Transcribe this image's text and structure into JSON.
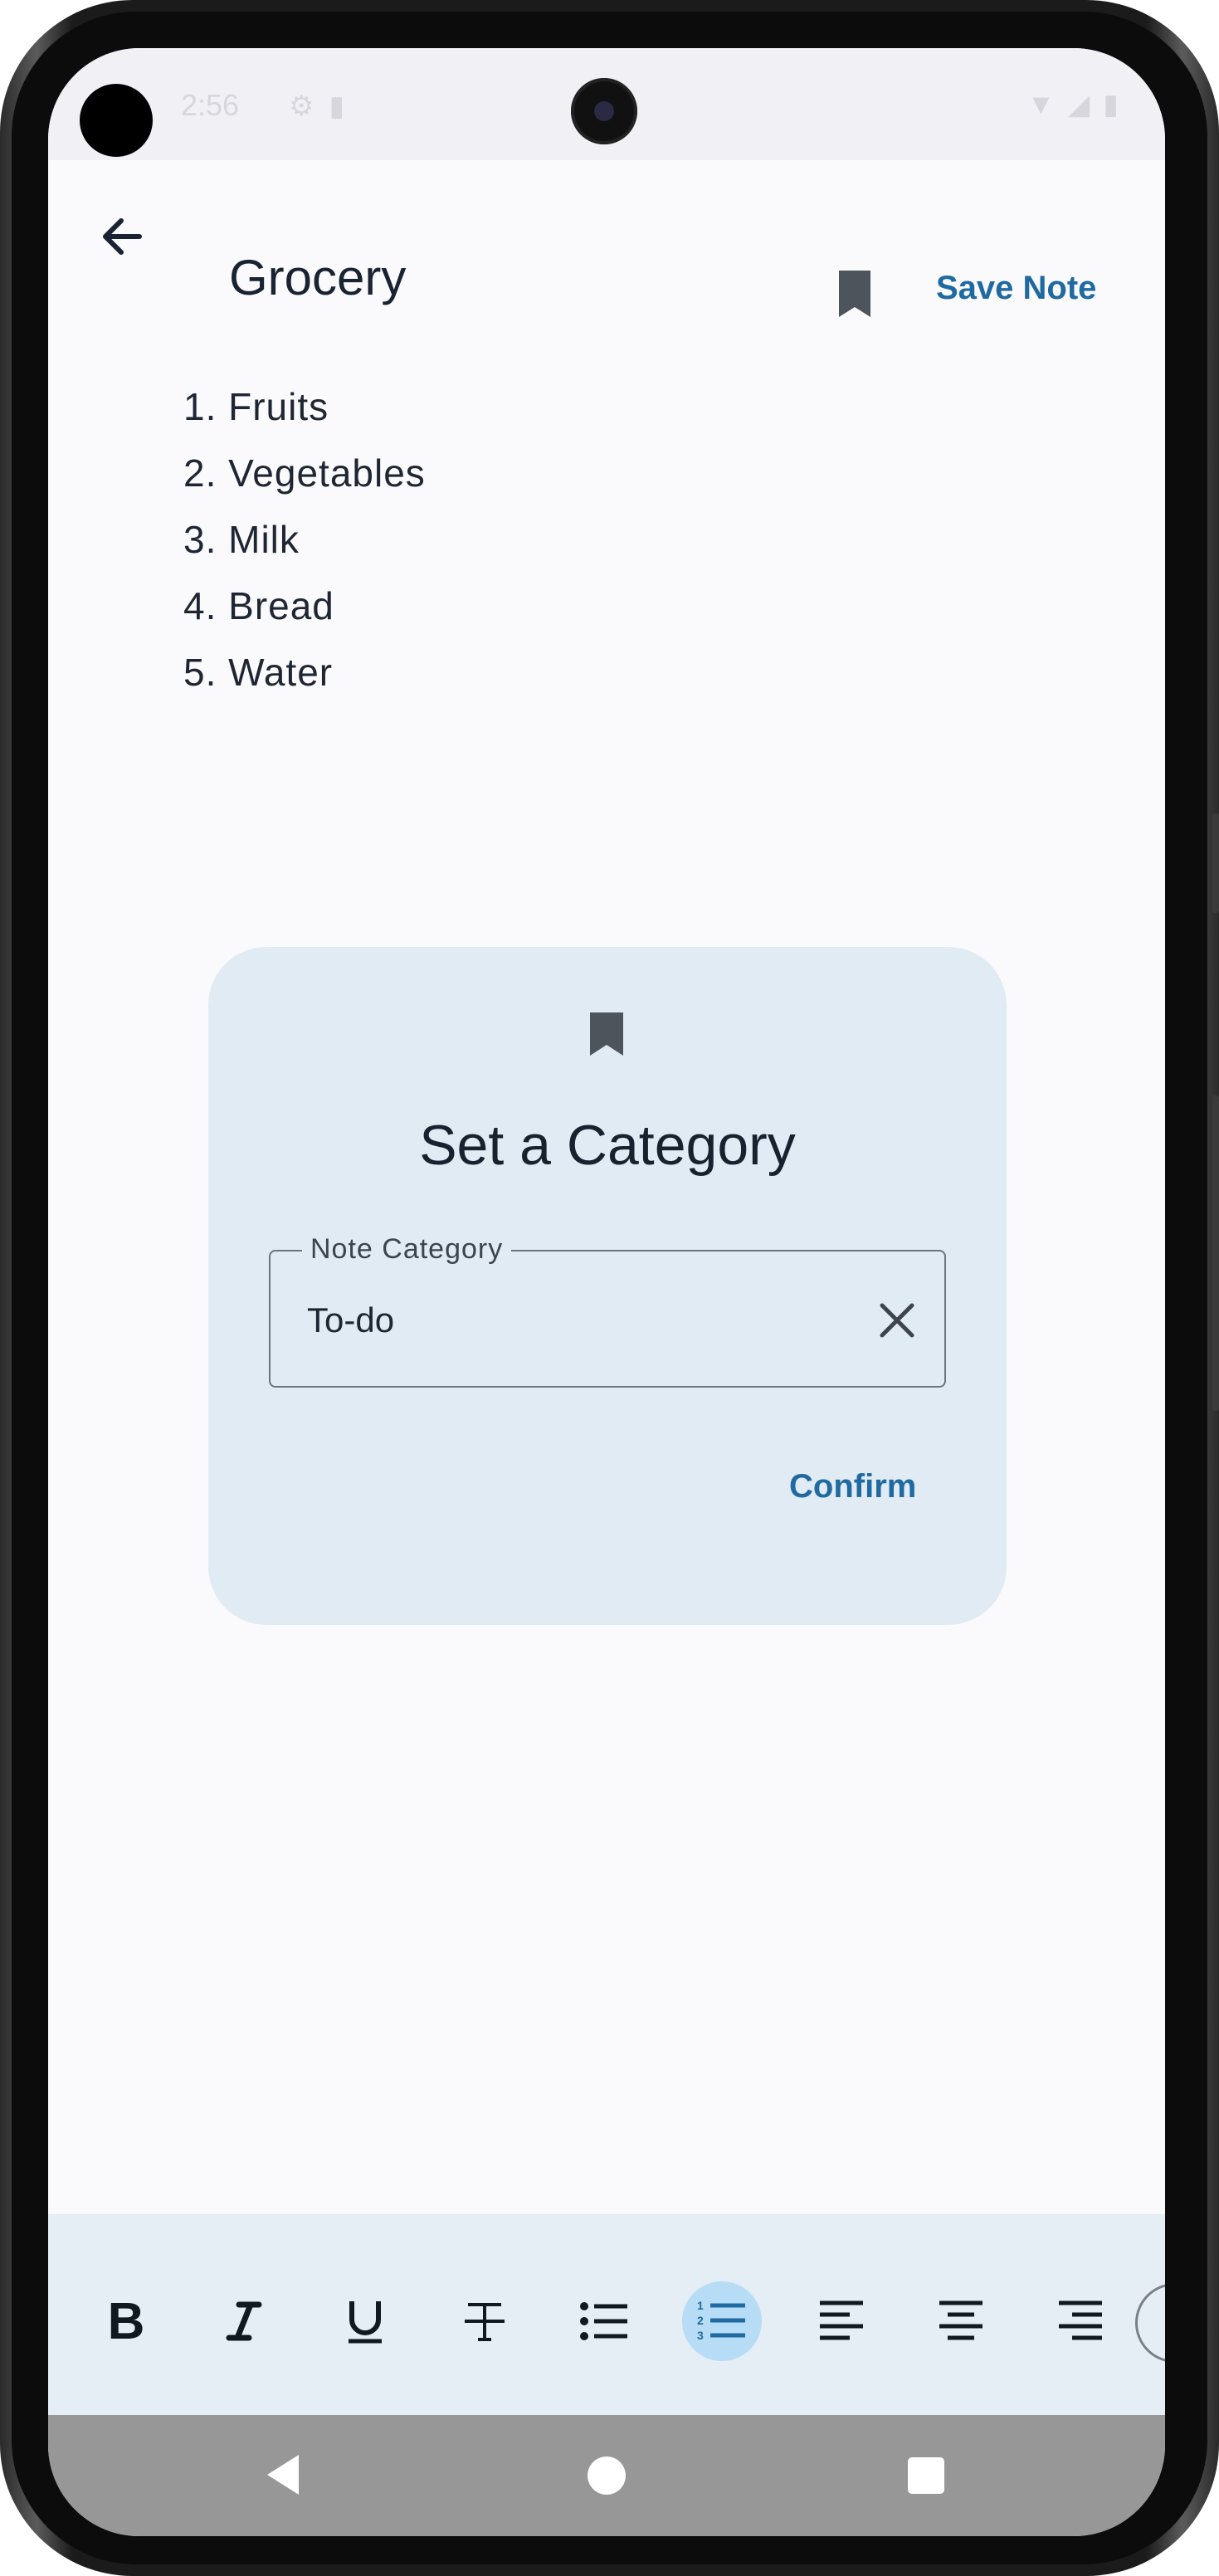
{
  "status_bar": {
    "time": "2:56"
  },
  "header": {
    "title": "Grocery",
    "save_label": "Save Note",
    "back_icon": "arrow-back-icon",
    "bookmark_icon": "bookmark-icon"
  },
  "note": {
    "items": [
      "1. Fruits",
      "2. Vegetables",
      "3. Milk",
      "4. Bread",
      "5. Water"
    ]
  },
  "dialog": {
    "icon": "bookmark-icon",
    "title": "Set a Category",
    "field_label": "Note Category",
    "field_value": "To-do",
    "clear_icon": "close-icon",
    "confirm_label": "Confirm"
  },
  "toolbar": {
    "bold_label": "B",
    "italic_label": "I",
    "underline_label": "U",
    "strike_label": "T"
  },
  "colors": {
    "accent": "#1f6aa0",
    "dialog_bg": "#e1ebf4",
    "active_tool_bg": "#b7dcf5",
    "toolbar_bg": "#e5edf5"
  }
}
